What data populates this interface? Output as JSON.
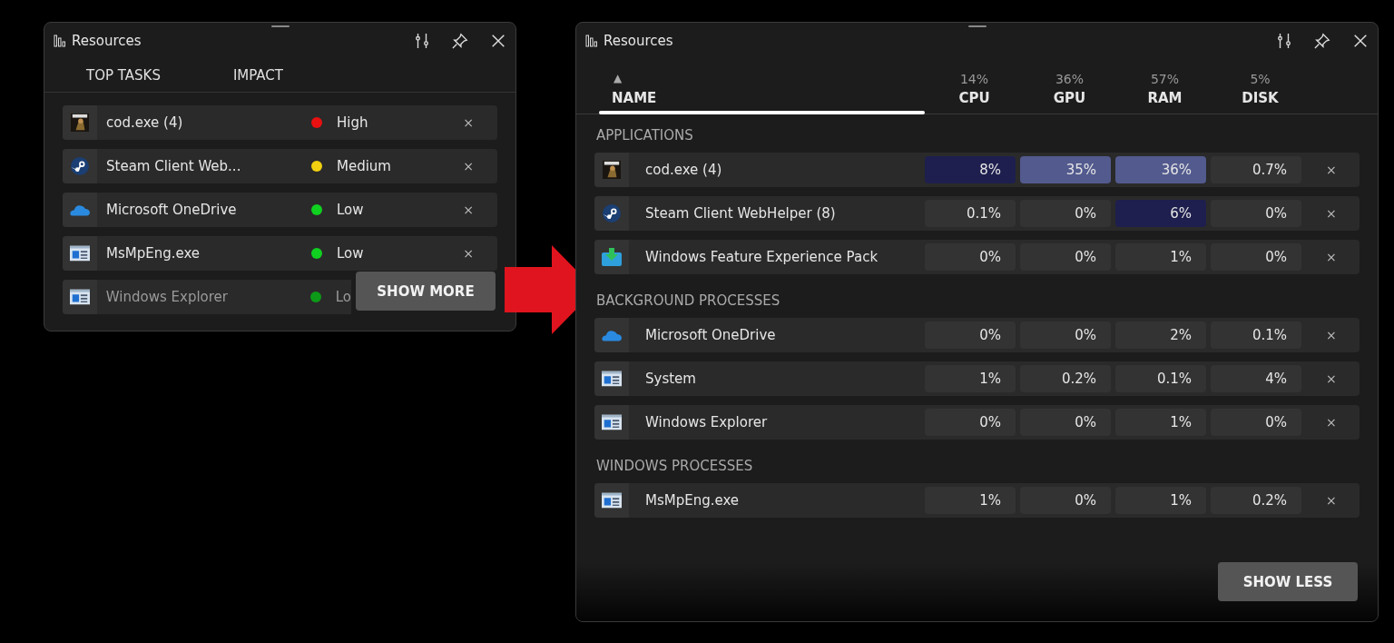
{
  "compact": {
    "title": "Resources",
    "tabs": [
      {
        "label": "TOP TASKS"
      },
      {
        "label": "IMPACT"
      }
    ],
    "rows": [
      {
        "kind": "game",
        "name": "cod.exe (4)",
        "impact": "High",
        "color": "#e81010"
      },
      {
        "kind": "steam",
        "name": "Steam Client Web...",
        "impact": "Medium",
        "color": "#f0d010"
      },
      {
        "kind": "cloud",
        "name": "Microsoft OneDrive",
        "impact": "Low",
        "color": "#10d020"
      },
      {
        "kind": "window",
        "name": "MsMpEng.exe",
        "impact": "Low",
        "color": "#10d020"
      },
      {
        "kind": "window",
        "name": "Windows Explorer",
        "impact": "Lo",
        "color": "#0c9a18"
      }
    ],
    "button": "SHOW MORE"
  },
  "expanded": {
    "title": "Resources",
    "sort_arrow": "▲",
    "columns": [
      {
        "label": "NAME",
        "selected": true
      },
      {
        "label": "CPU",
        "total": "14%",
        "selected": false
      },
      {
        "label": "GPU",
        "total": "36%",
        "selected": false
      },
      {
        "label": "RAM",
        "total": "57%",
        "selected": false
      },
      {
        "label": "DISK",
        "total": "5%",
        "selected": false
      }
    ],
    "groups": [
      {
        "title": "APPLICATIONS",
        "rows": [
          {
            "kind": "game",
            "name": "cod.exe (4)",
            "cells": [
              {
                "value": "8%",
                "color": "#1e1f4e"
              },
              {
                "value": "35%",
                "color": "#525a8e"
              },
              {
                "value": "36%",
                "color": "#525a8e"
              },
              {
                "value": "0.7%",
                "color": "#333333"
              }
            ]
          },
          {
            "kind": "steam",
            "name": "Steam Client WebHelper (8)",
            "cells": [
              {
                "value": "0.1%",
                "color": "#333333"
              },
              {
                "value": "0%",
                "color": "#333333"
              },
              {
                "value": "6%",
                "color": "#1e1f4e"
              },
              {
                "value": "0%",
                "color": "#333333"
              }
            ]
          },
          {
            "kind": "download",
            "name": "Windows Feature Experience Pack",
            "cells": [
              {
                "value": "0%",
                "color": "#333333"
              },
              {
                "value": "0%",
                "color": "#333333"
              },
              {
                "value": "1%",
                "color": "#333333"
              },
              {
                "value": "0%",
                "color": "#333333"
              }
            ]
          }
        ]
      },
      {
        "title": "BACKGROUND PROCESSES",
        "rows": [
          {
            "kind": "cloud",
            "name": "Microsoft OneDrive",
            "cells": [
              {
                "value": "0%",
                "color": "#333333"
              },
              {
                "value": "0%",
                "color": "#333333"
              },
              {
                "value": "2%",
                "color": "#333333"
              },
              {
                "value": "0.1%",
                "color": "#333333"
              }
            ]
          },
          {
            "kind": "window",
            "name": "System",
            "cells": [
              {
                "value": "1%",
                "color": "#333333"
              },
              {
                "value": "0.2%",
                "color": "#333333"
              },
              {
                "value": "0.1%",
                "color": "#333333"
              },
              {
                "value": "4%",
                "color": "#333333"
              }
            ]
          },
          {
            "kind": "window",
            "name": "Windows Explorer",
            "cells": [
              {
                "value": "0%",
                "color": "#333333"
              },
              {
                "value": "0%",
                "color": "#333333"
              },
              {
                "value": "1%",
                "color": "#333333"
              },
              {
                "value": "0%",
                "color": "#333333"
              }
            ]
          }
        ]
      },
      {
        "title": "WINDOWS PROCESSES",
        "rows": [
          {
            "kind": "window",
            "name": "MsMpEng.exe",
            "cells": [
              {
                "value": "1%",
                "color": "#333333"
              },
              {
                "value": "0%",
                "color": "#333333"
              },
              {
                "value": "1%",
                "color": "#333333"
              },
              {
                "value": "0.2%",
                "color": "#333333"
              }
            ]
          }
        ]
      }
    ],
    "button": "SHOW LESS"
  },
  "close_glyph": "×"
}
